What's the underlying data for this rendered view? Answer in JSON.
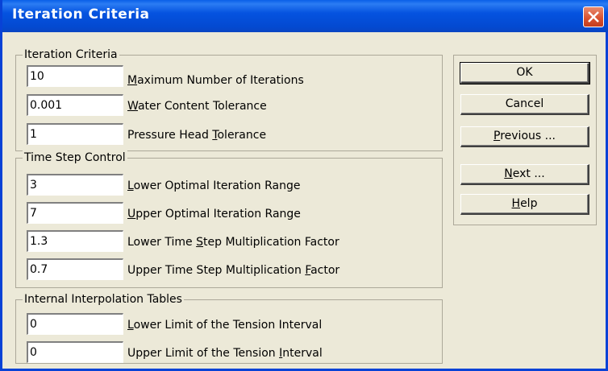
{
  "window": {
    "title": "Iteration Criteria"
  },
  "groups": {
    "iteration": {
      "title": "Iteration Criteria",
      "fields": [
        {
          "value": "10",
          "pre": "",
          "key": "M",
          "post": "aximum Number of Iterations"
        },
        {
          "value": "0.001",
          "pre": "",
          "key": "W",
          "post": "ater Content Tolerance"
        },
        {
          "value": "1",
          "pre": "Pressure Head ",
          "key": "T",
          "post": "olerance"
        }
      ]
    },
    "timestep": {
      "title": "Time Step Control",
      "fields": [
        {
          "value": "3",
          "pre": "",
          "key": "L",
          "post": "ower Optimal Iteration Range"
        },
        {
          "value": "7",
          "pre": "",
          "key": "U",
          "post": "pper Optimal Iteration Range"
        },
        {
          "value": "1.3",
          "pre": "Lower Time ",
          "key": "S",
          "post": "tep Multiplication Factor"
        },
        {
          "value": "0.7",
          "pre": "Upper Time Step Multiplication ",
          "key": "F",
          "post": "actor"
        }
      ]
    },
    "interp": {
      "title": "Internal Interpolation Tables",
      "fields": [
        {
          "value": "0",
          "pre": "",
          "key": "L",
          "post": "ower Limit of the Tension Interval"
        },
        {
          "value": "0",
          "pre": "Upper Limit of the Tension ",
          "key": "I",
          "post": "nterval"
        }
      ]
    }
  },
  "buttons": {
    "ok": "OK",
    "cancel": "Cancel",
    "previous": {
      "key": "P",
      "post": "revious ..."
    },
    "next": {
      "key": "N",
      "post": "ext ..."
    },
    "help": {
      "key": "H",
      "post": "elp"
    }
  }
}
